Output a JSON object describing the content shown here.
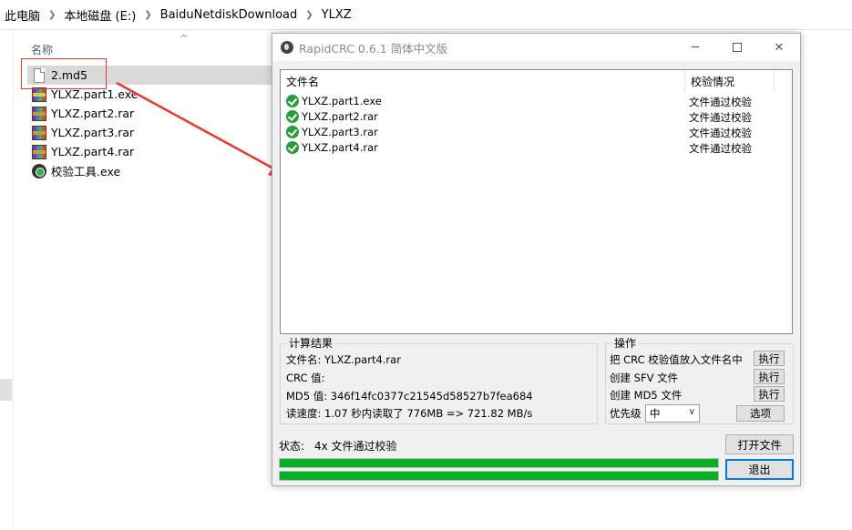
{
  "explorer": {
    "breadcrumb": [
      "此电脑",
      "本地磁盘 (E:)",
      "BaiduNetdiskDownload",
      "YLXZ"
    ],
    "column_name": "名称",
    "files": [
      {
        "name": "2.md5",
        "icon": "document-icon",
        "selected": true
      },
      {
        "name": "YLXZ.part1.exe",
        "icon": "winrar-sfx-icon"
      },
      {
        "name": "YLXZ.part2.rar",
        "icon": "winrar-archive-icon"
      },
      {
        "name": "YLXZ.part3.rar",
        "icon": "winrar-archive-icon"
      },
      {
        "name": "YLXZ.part4.rar",
        "icon": "winrar-archive-icon"
      },
      {
        "name": "校验工具.exe",
        "icon": "rapidcrc-app-icon"
      }
    ]
  },
  "annotation": {
    "color": "#e53935"
  },
  "window": {
    "title": "RapidCRC 0.6.1 简体中文版",
    "controls": {
      "minimize": "─",
      "close": "✕"
    },
    "list": {
      "header_filename": "文件名",
      "header_status": "校验情况",
      "rows": [
        {
          "name": "YLXZ.part1.exe",
          "status": "文件通过校验"
        },
        {
          "name": "YLXZ.part2.rar",
          "status": "文件通过校验"
        },
        {
          "name": "YLXZ.part3.rar",
          "status": "文件通过校验"
        },
        {
          "name": "YLXZ.part4.rar",
          "status": "文件通过校验"
        }
      ]
    },
    "result": {
      "title": "计算结果",
      "filename": "文件名: YLXZ.part4.rar",
      "crc": "CRC 值:",
      "md5": "MD5 值: 346f14fc0377c21545d58527b7fea684",
      "speed": "读速度: 1.07 秒内读取了 776MB => 721.82 MB/s"
    },
    "ops": {
      "title": "操作",
      "crc_to_name": "把 CRC 校验值放入文件名中",
      "create_sfv": "创建 SFV 文件",
      "create_md5": "创建 MD5 文件",
      "execute": "执行",
      "priority_label": "优先级",
      "priority_value": "中",
      "options": "选项"
    },
    "status_label": "状态:",
    "status_text": "4x 文件通过校验",
    "open_file": "打开文件",
    "exit": "退出",
    "progress": [
      1.0,
      1.0
    ],
    "accent_green": "#06b025"
  }
}
